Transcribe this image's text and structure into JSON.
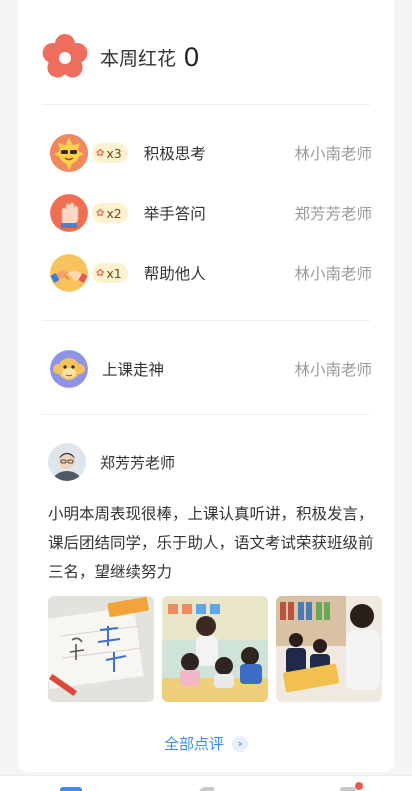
{
  "header": {
    "label": "本周红花",
    "count": "0",
    "icon": "flower-icon"
  },
  "awards": [
    {
      "icon": "sun-avatar",
      "badge": "x3",
      "label": "积极思考",
      "teacher": "林小南老师"
    },
    {
      "icon": "hand-avatar",
      "badge": "x2",
      "label": "举手答问",
      "teacher": "郑芳芳老师"
    },
    {
      "icon": "handshake-avatar",
      "badge": "x1",
      "label": "帮助他人",
      "teacher": "林小南老师"
    }
  ],
  "penalty": {
    "icon": "monkey-avatar",
    "label": "上课走神",
    "teacher": "林小南老师"
  },
  "comment": {
    "teacher": "郑芳芳老师",
    "text": "小明本周表现很棒，上课认真听讲，积极发言，课后团结同学，乐于助人，语文考试荣获班级前三名，望继续努力",
    "photos": [
      "chinese-characters-photo",
      "classroom-photo",
      "reading-photo"
    ]
  },
  "all_reviews": "全部点评",
  "colors": {
    "accent": "#3a8ee6",
    "flower": "#ef6d5f",
    "badge_bg": "#fdf2cf"
  }
}
